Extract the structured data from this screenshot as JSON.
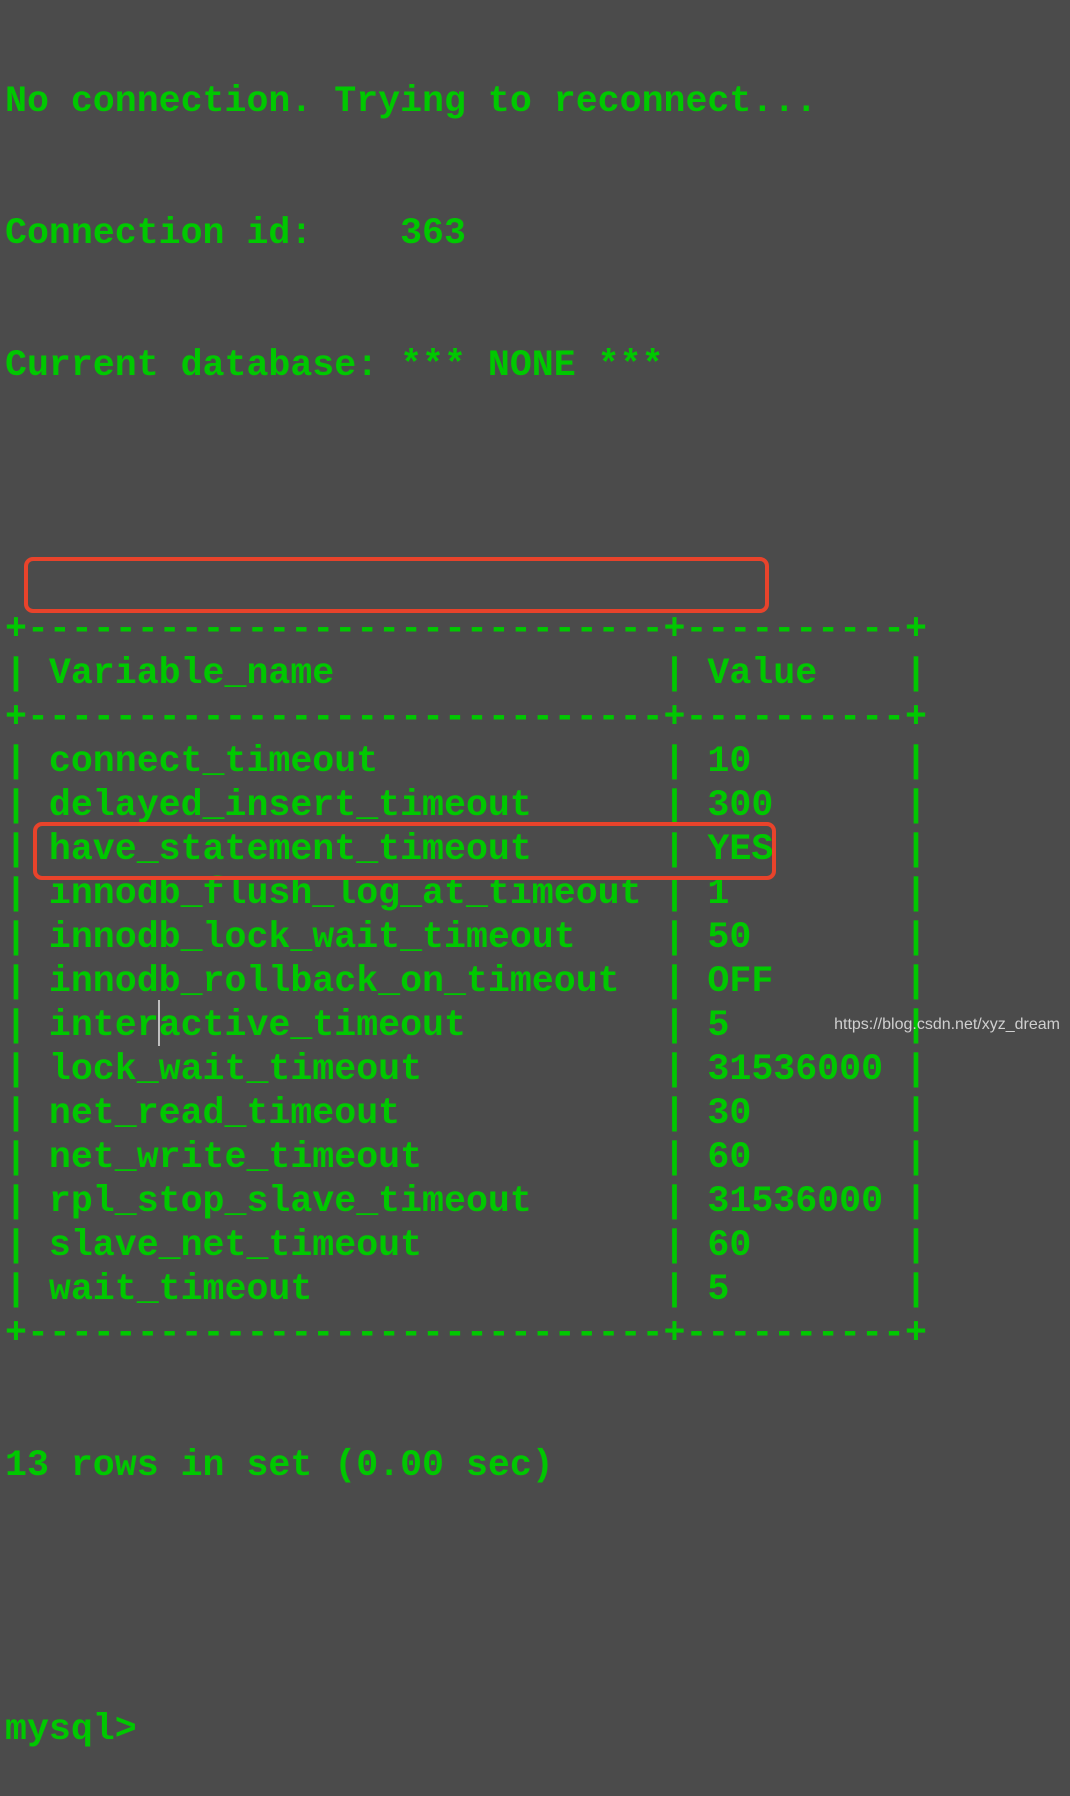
{
  "terminal": {
    "status_lines": [
      "No connection. Trying to reconnect...",
      "Connection id:    363",
      "Current database: *** NONE ***"
    ],
    "table": {
      "columns": [
        "Variable_name",
        "Value"
      ],
      "rows": [
        {
          "name": "connect_timeout",
          "value": "10"
        },
        {
          "name": "delayed_insert_timeout",
          "value": "300"
        },
        {
          "name": "have_statement_timeout",
          "value": "YES"
        },
        {
          "name": "innodb_flush_log_at_timeout",
          "value": "1"
        },
        {
          "name": "innodb_lock_wait_timeout",
          "value": "50"
        },
        {
          "name": "innodb_rollback_on_timeout",
          "value": "OFF"
        },
        {
          "name": "interactive_timeout",
          "value": "5",
          "highlighted": true
        },
        {
          "name": "lock_wait_timeout",
          "value": "31536000"
        },
        {
          "name": "net_read_timeout",
          "value": "30"
        },
        {
          "name": "net_write_timeout",
          "value": "60"
        },
        {
          "name": "rpl_stop_slave_timeout",
          "value": "31536000"
        },
        {
          "name": "slave_net_timeout",
          "value": "60"
        },
        {
          "name": "wait_timeout",
          "value": "5",
          "highlighted": true
        }
      ]
    },
    "result_summary": "13 rows in set (0.00 sec)",
    "prompt": "mysql>",
    "input_value": ""
  },
  "colors": {
    "background": "#4b4b4b",
    "text": "#00c800",
    "highlight_box": "#e8432b"
  },
  "watermark": "https://blog.csdn.net/xyz_dream"
}
